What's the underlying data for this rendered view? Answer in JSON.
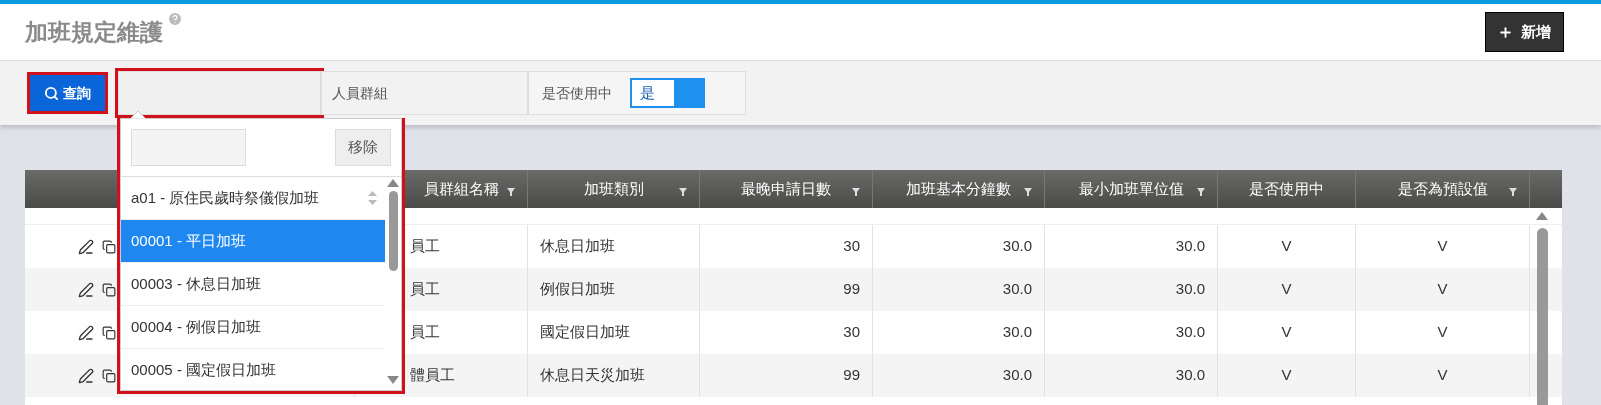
{
  "page": {
    "title": "加班規定維護",
    "add_button": "新增"
  },
  "toolbar": {
    "query_button": "查詢",
    "group_select": {
      "label": "人員群組"
    },
    "in_use": {
      "label": "是否使用中",
      "value": "是",
      "on": true
    }
  },
  "dropdown": {
    "remove_button": "移除",
    "items": [
      {
        "label": "a01 - 原住民歲時祭儀假加班",
        "selected": false
      },
      {
        "label": "00001 - 平日加班",
        "selected": true
      },
      {
        "label": "00003 - 休息日加班",
        "selected": false
      },
      {
        "label": "00004 - 例假日加班",
        "selected": false
      },
      {
        "label": "00005 - 國定假日加班",
        "selected": false
      }
    ]
  },
  "table": {
    "columns": [
      {
        "label": "員群組名稱",
        "filter": true
      },
      {
        "label": "加班類別",
        "filter": true
      },
      {
        "label": "最晚申請日數",
        "filter": true
      },
      {
        "label": "加班基本分鐘數",
        "filter": true
      },
      {
        "label": "最小加班單位值",
        "filter": true
      },
      {
        "label": "是否使用中",
        "filter": false
      },
      {
        "label": "是否為預設值",
        "filter": true
      }
    ],
    "rows": [
      {
        "group": "員工",
        "type": "休息日加班",
        "days": "30",
        "minutes": "30.0",
        "unit": "30.0",
        "in_use": "V",
        "default": "V"
      },
      {
        "group": "員工",
        "type": "例假日加班",
        "days": "99",
        "minutes": "30.0",
        "unit": "30.0",
        "in_use": "V",
        "default": "V"
      },
      {
        "group": "員工",
        "type": "國定假日加班",
        "days": "30",
        "minutes": "30.0",
        "unit": "30.0",
        "in_use": "V",
        "default": "V"
      },
      {
        "group": "體員工",
        "type": "休息日天災加班",
        "days": "99",
        "minutes": "30.0",
        "unit": "30.0",
        "in_use": "V",
        "default": "V"
      }
    ]
  }
}
